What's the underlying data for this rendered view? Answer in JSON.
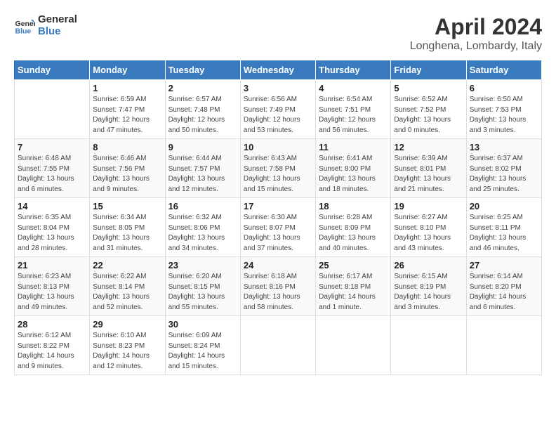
{
  "header": {
    "logo_line1": "General",
    "logo_line2": "Blue",
    "title": "April 2024",
    "subtitle": "Longhena, Lombardy, Italy"
  },
  "weekdays": [
    "Sunday",
    "Monday",
    "Tuesday",
    "Wednesday",
    "Thursday",
    "Friday",
    "Saturday"
  ],
  "weeks": [
    [
      {
        "day": "",
        "info": ""
      },
      {
        "day": "1",
        "info": "Sunrise: 6:59 AM\nSunset: 7:47 PM\nDaylight: 12 hours\nand 47 minutes."
      },
      {
        "day": "2",
        "info": "Sunrise: 6:57 AM\nSunset: 7:48 PM\nDaylight: 12 hours\nand 50 minutes."
      },
      {
        "day": "3",
        "info": "Sunrise: 6:56 AM\nSunset: 7:49 PM\nDaylight: 12 hours\nand 53 minutes."
      },
      {
        "day": "4",
        "info": "Sunrise: 6:54 AM\nSunset: 7:51 PM\nDaylight: 12 hours\nand 56 minutes."
      },
      {
        "day": "5",
        "info": "Sunrise: 6:52 AM\nSunset: 7:52 PM\nDaylight: 13 hours\nand 0 minutes."
      },
      {
        "day": "6",
        "info": "Sunrise: 6:50 AM\nSunset: 7:53 PM\nDaylight: 13 hours\nand 3 minutes."
      }
    ],
    [
      {
        "day": "7",
        "info": "Sunrise: 6:48 AM\nSunset: 7:55 PM\nDaylight: 13 hours\nand 6 minutes."
      },
      {
        "day": "8",
        "info": "Sunrise: 6:46 AM\nSunset: 7:56 PM\nDaylight: 13 hours\nand 9 minutes."
      },
      {
        "day": "9",
        "info": "Sunrise: 6:44 AM\nSunset: 7:57 PM\nDaylight: 13 hours\nand 12 minutes."
      },
      {
        "day": "10",
        "info": "Sunrise: 6:43 AM\nSunset: 7:58 PM\nDaylight: 13 hours\nand 15 minutes."
      },
      {
        "day": "11",
        "info": "Sunrise: 6:41 AM\nSunset: 8:00 PM\nDaylight: 13 hours\nand 18 minutes."
      },
      {
        "day": "12",
        "info": "Sunrise: 6:39 AM\nSunset: 8:01 PM\nDaylight: 13 hours\nand 21 minutes."
      },
      {
        "day": "13",
        "info": "Sunrise: 6:37 AM\nSunset: 8:02 PM\nDaylight: 13 hours\nand 25 minutes."
      }
    ],
    [
      {
        "day": "14",
        "info": "Sunrise: 6:35 AM\nSunset: 8:04 PM\nDaylight: 13 hours\nand 28 minutes."
      },
      {
        "day": "15",
        "info": "Sunrise: 6:34 AM\nSunset: 8:05 PM\nDaylight: 13 hours\nand 31 minutes."
      },
      {
        "day": "16",
        "info": "Sunrise: 6:32 AM\nSunset: 8:06 PM\nDaylight: 13 hours\nand 34 minutes."
      },
      {
        "day": "17",
        "info": "Sunrise: 6:30 AM\nSunset: 8:07 PM\nDaylight: 13 hours\nand 37 minutes."
      },
      {
        "day": "18",
        "info": "Sunrise: 6:28 AM\nSunset: 8:09 PM\nDaylight: 13 hours\nand 40 minutes."
      },
      {
        "day": "19",
        "info": "Sunrise: 6:27 AM\nSunset: 8:10 PM\nDaylight: 13 hours\nand 43 minutes."
      },
      {
        "day": "20",
        "info": "Sunrise: 6:25 AM\nSunset: 8:11 PM\nDaylight: 13 hours\nand 46 minutes."
      }
    ],
    [
      {
        "day": "21",
        "info": "Sunrise: 6:23 AM\nSunset: 8:13 PM\nDaylight: 13 hours\nand 49 minutes."
      },
      {
        "day": "22",
        "info": "Sunrise: 6:22 AM\nSunset: 8:14 PM\nDaylight: 13 hours\nand 52 minutes."
      },
      {
        "day": "23",
        "info": "Sunrise: 6:20 AM\nSunset: 8:15 PM\nDaylight: 13 hours\nand 55 minutes."
      },
      {
        "day": "24",
        "info": "Sunrise: 6:18 AM\nSunset: 8:16 PM\nDaylight: 13 hours\nand 58 minutes."
      },
      {
        "day": "25",
        "info": "Sunrise: 6:17 AM\nSunset: 8:18 PM\nDaylight: 14 hours\nand 1 minute."
      },
      {
        "day": "26",
        "info": "Sunrise: 6:15 AM\nSunset: 8:19 PM\nDaylight: 14 hours\nand 3 minutes."
      },
      {
        "day": "27",
        "info": "Sunrise: 6:14 AM\nSunset: 8:20 PM\nDaylight: 14 hours\nand 6 minutes."
      }
    ],
    [
      {
        "day": "28",
        "info": "Sunrise: 6:12 AM\nSunset: 8:22 PM\nDaylight: 14 hours\nand 9 minutes."
      },
      {
        "day": "29",
        "info": "Sunrise: 6:10 AM\nSunset: 8:23 PM\nDaylight: 14 hours\nand 12 minutes."
      },
      {
        "day": "30",
        "info": "Sunrise: 6:09 AM\nSunset: 8:24 PM\nDaylight: 14 hours\nand 15 minutes."
      },
      {
        "day": "",
        "info": ""
      },
      {
        "day": "",
        "info": ""
      },
      {
        "day": "",
        "info": ""
      },
      {
        "day": "",
        "info": ""
      }
    ]
  ]
}
